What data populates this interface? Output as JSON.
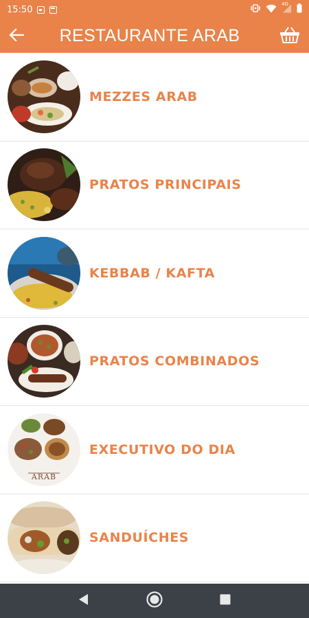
{
  "status_bar": {
    "time": "15:50",
    "network_label": "4G",
    "icons": [
      "message-icon",
      "calendar-icon",
      "vibrate-icon",
      "wifi-icon",
      "signal-icon",
      "battery-icon"
    ]
  },
  "app_bar": {
    "title": "RESTAURANTE ARAB",
    "back_icon": "arrow-back-icon",
    "cart_icon": "basket-icon"
  },
  "menu": {
    "items": [
      {
        "label": "MEZZES ARAB",
        "image": "mezzes-thumbnail"
      },
      {
        "label": "PRATOS PRINCIPAIS",
        "image": "pratos-principais-thumbnail"
      },
      {
        "label": "KEBBAB / KAFTA",
        "image": "kebbab-kafta-thumbnail"
      },
      {
        "label": "PRATOS COMBINADOS",
        "image": "pratos-combinados-thumbnail"
      },
      {
        "label": "EXECUTIVO DO DIA",
        "image": "executivo-do-dia-thumbnail",
        "image_caption": "ARAB"
      },
      {
        "label": "SANDUÍCHES",
        "image": "sanduiches-thumbnail"
      }
    ]
  },
  "nav_bar": {
    "icons": [
      "back-triangle-icon",
      "home-circle-icon",
      "recents-square-icon"
    ]
  },
  "colors": {
    "accent": "#e9834a",
    "nav_bar": "#3b4147",
    "divider": "#e4e4e4"
  }
}
